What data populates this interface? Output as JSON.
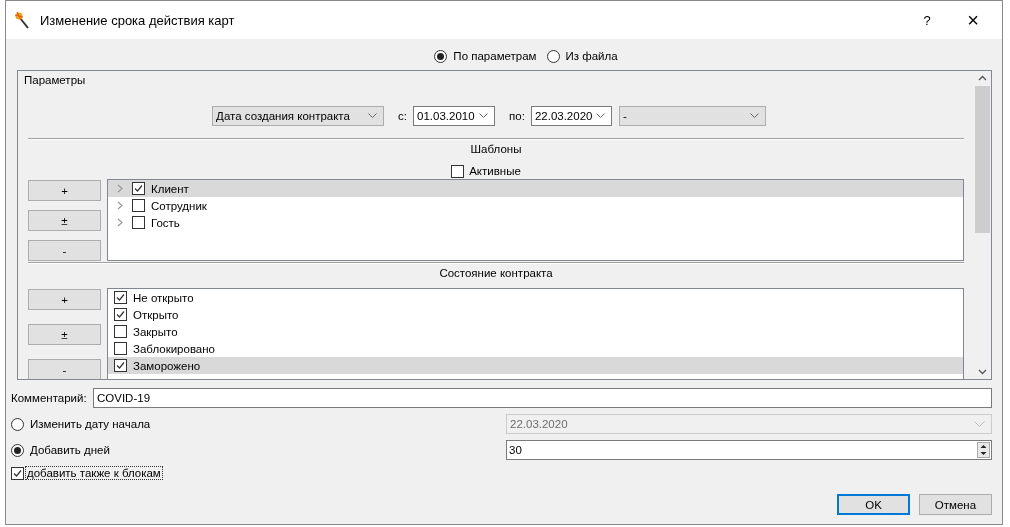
{
  "window": {
    "title": "Изменение срока действия карт",
    "help": "?",
    "close": "×"
  },
  "mode_options": [
    {
      "label": "По параметрам",
      "selected": true
    },
    {
      "label": "Из файла",
      "selected": false
    }
  ],
  "parameters": {
    "title": "Параметры",
    "filter": {
      "field": "Дата создания контракта",
      "from_label": "с:",
      "from": "01.03.2010",
      "to_label": "по:",
      "to": "22.03.2020",
      "extra": "-"
    },
    "templates": {
      "title": "Шаблоны",
      "active": {
        "label": "Активные",
        "checked": false
      },
      "buttons": [
        "+",
        "±",
        "-"
      ],
      "items": [
        {
          "label": "Клиент",
          "checked": true,
          "selected": true,
          "expanded": false
        },
        {
          "label": "Сотрудник",
          "checked": false,
          "selected": false,
          "expanded": false
        },
        {
          "label": "Гость",
          "checked": false,
          "selected": false,
          "expanded": false
        }
      ]
    },
    "states": {
      "title": "Состояние контракта",
      "buttons": [
        "+",
        "±",
        "-"
      ],
      "items": [
        {
          "label": "Не открыто",
          "checked": true,
          "selected": false
        },
        {
          "label": "Открыто",
          "checked": true,
          "selected": false
        },
        {
          "label": "Закрыто",
          "checked": false,
          "selected": false
        },
        {
          "label": "Заблокировано",
          "checked": false,
          "selected": false
        },
        {
          "label": "Заморожено",
          "checked": true,
          "selected": true
        }
      ]
    }
  },
  "comment": {
    "label": "Комментарий:",
    "value": "COVID-19"
  },
  "start_date": {
    "label": "Изменить дату начала",
    "selected": false,
    "value": "22.03.2020"
  },
  "add_days": {
    "label": "Добавить дней",
    "selected": true,
    "value": "30"
  },
  "also_blocks": {
    "label": "добавить также к блокам",
    "checked": true,
    "focused": true
  },
  "buttons": [
    {
      "label": "OK",
      "default": true
    },
    {
      "label": "Отмена",
      "default": false
    }
  ]
}
